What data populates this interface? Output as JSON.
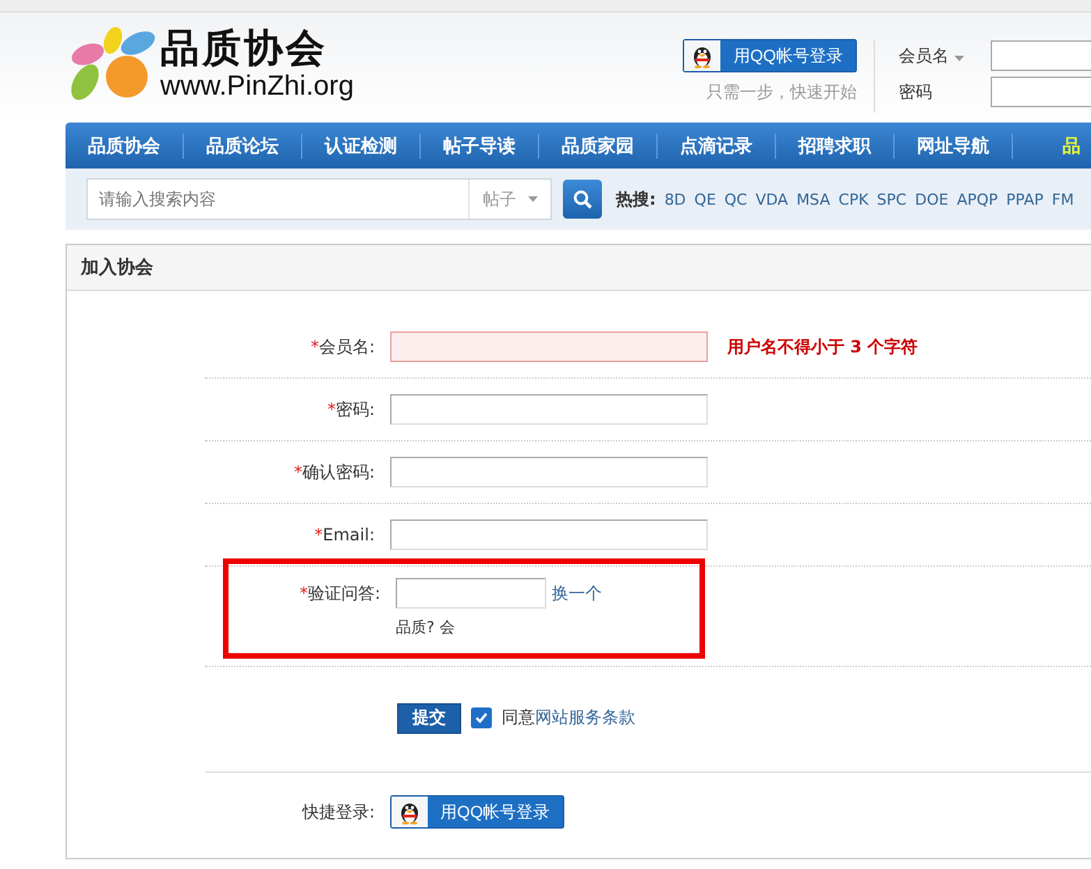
{
  "header": {
    "logo_title": "品质协会",
    "logo_url": "www.PinZhi.org",
    "qq_login": "用QQ帐号登录",
    "qq_tip": "只需一步，快速开始",
    "member_label": "会员名",
    "password_label": "密码"
  },
  "nav": [
    {
      "label": "品质协会",
      "selected": false
    },
    {
      "label": "品质论坛",
      "selected": false
    },
    {
      "label": "认证检测",
      "selected": false
    },
    {
      "label": "帖子导读",
      "selected": false
    },
    {
      "label": "品质家园",
      "selected": false
    },
    {
      "label": "点滴记录",
      "selected": false
    },
    {
      "label": "招聘求职",
      "selected": false
    },
    {
      "label": "网址导航",
      "selected": false
    },
    {
      "label": "品",
      "selected": true
    }
  ],
  "search": {
    "placeholder": "请输入搜索内容",
    "scope": "帖子",
    "hot_label": "热搜:",
    "hot": [
      "8D",
      "QE",
      "QC",
      "VDA",
      "MSA",
      "CPK",
      "SPC",
      "DOE",
      "APQP",
      "PPAP",
      "FM"
    ]
  },
  "panel": {
    "title": "加入协会"
  },
  "fields": [
    {
      "mark": "*",
      "label": "会员名:",
      "error": true,
      "message": "用户名不得小于 3 个字符"
    },
    {
      "mark": "*",
      "label": "密码:",
      "error": false
    },
    {
      "mark": "*",
      "label": "确认密码:",
      "error": false
    },
    {
      "mark": "*",
      "label": "Email:",
      "error": false
    }
  ],
  "captcha": {
    "mark": "*",
    "label": "验证问答:",
    "refresh": "换一个",
    "question": "品质? 会",
    "highlighted": true
  },
  "submit": "提交",
  "agree": {
    "checked": true,
    "prefix": "同意",
    "link": "网站服务条款"
  },
  "quick_login": {
    "label": "快捷登录:",
    "button": "用QQ帐号登录"
  }
}
